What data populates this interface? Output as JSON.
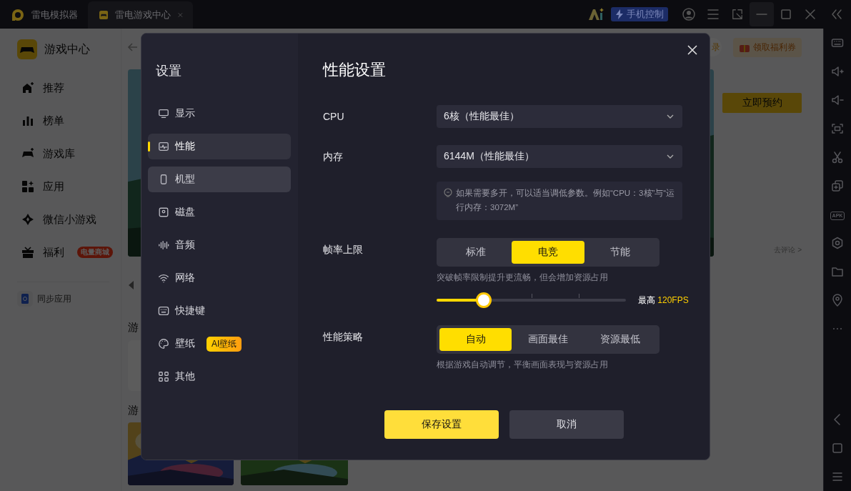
{
  "titlebar": {
    "tabs": [
      {
        "label": "雷电模拟器",
        "selected": false
      },
      {
        "label": "雷电游戏中心",
        "selected": true
      }
    ],
    "phone_control": "手机控制"
  },
  "game_center": {
    "title": "游戏中心",
    "nav": [
      {
        "label": "推荐"
      },
      {
        "label": "榜单"
      },
      {
        "label": "游戏库"
      },
      {
        "label": "应用"
      },
      {
        "label": "微信小游戏"
      },
      {
        "label": "福利",
        "badge": "电量商城"
      }
    ],
    "sync_app": "同步应用",
    "login": "录",
    "coupon": "领取福利券",
    "reserve": "立即预约",
    "comment": "去评论 >",
    "section_titles": [
      "游",
      "游"
    ]
  },
  "toolbar": {
    "apk_label": "APK"
  },
  "settings": {
    "title": "设置",
    "nav": [
      {
        "label": "显示",
        "selected": false,
        "hover": false
      },
      {
        "label": "性能",
        "selected": true,
        "hover": false
      },
      {
        "label": "机型",
        "selected": false,
        "hover": true
      },
      {
        "label": "磁盘",
        "selected": false,
        "hover": false
      },
      {
        "label": "音频",
        "selected": false,
        "hover": false
      },
      {
        "label": "网络",
        "selected": false,
        "hover": false
      },
      {
        "label": "快捷键",
        "selected": false,
        "hover": false
      },
      {
        "label": "壁纸",
        "selected": false,
        "hover": false,
        "badge": "AI壁纸"
      },
      {
        "label": "其他",
        "selected": false,
        "hover": false
      }
    ],
    "heading": "性能设置",
    "cpu": {
      "label": "CPU",
      "value": "6核（性能最佳）"
    },
    "memory": {
      "label": "内存",
      "value": "6144M（性能最佳）"
    },
    "hint": "如果需要多开，可以适当调低参数。例如“CPU：3核”与“运行内存：3072M”",
    "frame_rate": {
      "label": "帧率上限",
      "options": [
        {
          "label": "标准",
          "selected": false
        },
        {
          "label": "电竞",
          "selected": true
        },
        {
          "label": "节能",
          "selected": false
        }
      ],
      "description": "突破帧率限制提升更流畅，但会增加资源占用",
      "level": 0.25,
      "max_label": "最高",
      "max_value": "120FPS"
    },
    "strategy": {
      "label": "性能策略",
      "options": [
        {
          "label": "自动",
          "selected": true
        },
        {
          "label": "画面最佳",
          "selected": false
        },
        {
          "label": "资源最低",
          "selected": false
        }
      ],
      "description": "根据游戏自动调节，平衡画面表现与资源占用"
    },
    "buttons": [
      {
        "label": "保存设置",
        "kind": "primary"
      },
      {
        "label": "取消",
        "kind": "secondary"
      }
    ]
  }
}
